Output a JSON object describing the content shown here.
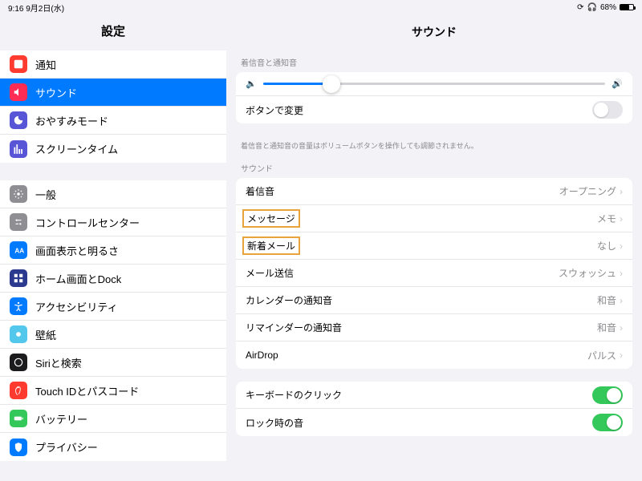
{
  "status": {
    "time": "9:16",
    "date": "9月2日(水)",
    "battery": "68%"
  },
  "sidebar": {
    "title": "設定",
    "g1": [
      {
        "label": "通知",
        "color": "#ff3b30"
      },
      {
        "label": "サウンド",
        "color": "#ff2d55",
        "selected": true
      },
      {
        "label": "おやすみモード",
        "color": "#5856d6"
      },
      {
        "label": "スクリーンタイム",
        "color": "#5856d6"
      }
    ],
    "g2": [
      {
        "label": "一般",
        "color": "#8e8e93"
      },
      {
        "label": "コントロールセンター",
        "color": "#8e8e93"
      },
      {
        "label": "画面表示と明るさ",
        "color": "#007aff"
      },
      {
        "label": "ホーム画面とDock",
        "color": "#2b3a8f"
      },
      {
        "label": "アクセシビリティ",
        "color": "#007aff"
      },
      {
        "label": "壁紙",
        "color": "#54c7ec"
      },
      {
        "label": "Siriと検索",
        "color": "#1c1c1e"
      },
      {
        "label": "Touch IDとパスコード",
        "color": "#ff3b30"
      },
      {
        "label": "バッテリー",
        "color": "#34c759"
      },
      {
        "label": "プライバシー",
        "color": "#007aff"
      }
    ]
  },
  "detail": {
    "title": "サウンド",
    "sec1": {
      "header": "着信音と通知音",
      "changeWithButtons": "ボタンで変更",
      "footer": "着信音と通知音の音量はボリュームボタンを操作しても調節されません。"
    },
    "sec2": {
      "header": "サウンド",
      "items": [
        {
          "k": "着信音",
          "v": "オープニング"
        },
        {
          "k": "メッセージ",
          "v": "メモ",
          "hl": true
        },
        {
          "k": "新着メール",
          "v": "なし",
          "hl": true
        },
        {
          "k": "メール送信",
          "v": "スウォッシュ"
        },
        {
          "k": "カレンダーの通知音",
          "v": "和音"
        },
        {
          "k": "リマインダーの通知音",
          "v": "和音"
        },
        {
          "k": "AirDrop",
          "v": "パルス"
        }
      ]
    },
    "sec3": {
      "items": [
        {
          "k": "キーボードのクリック",
          "on": true
        },
        {
          "k": "ロック時の音",
          "on": true
        }
      ]
    }
  }
}
